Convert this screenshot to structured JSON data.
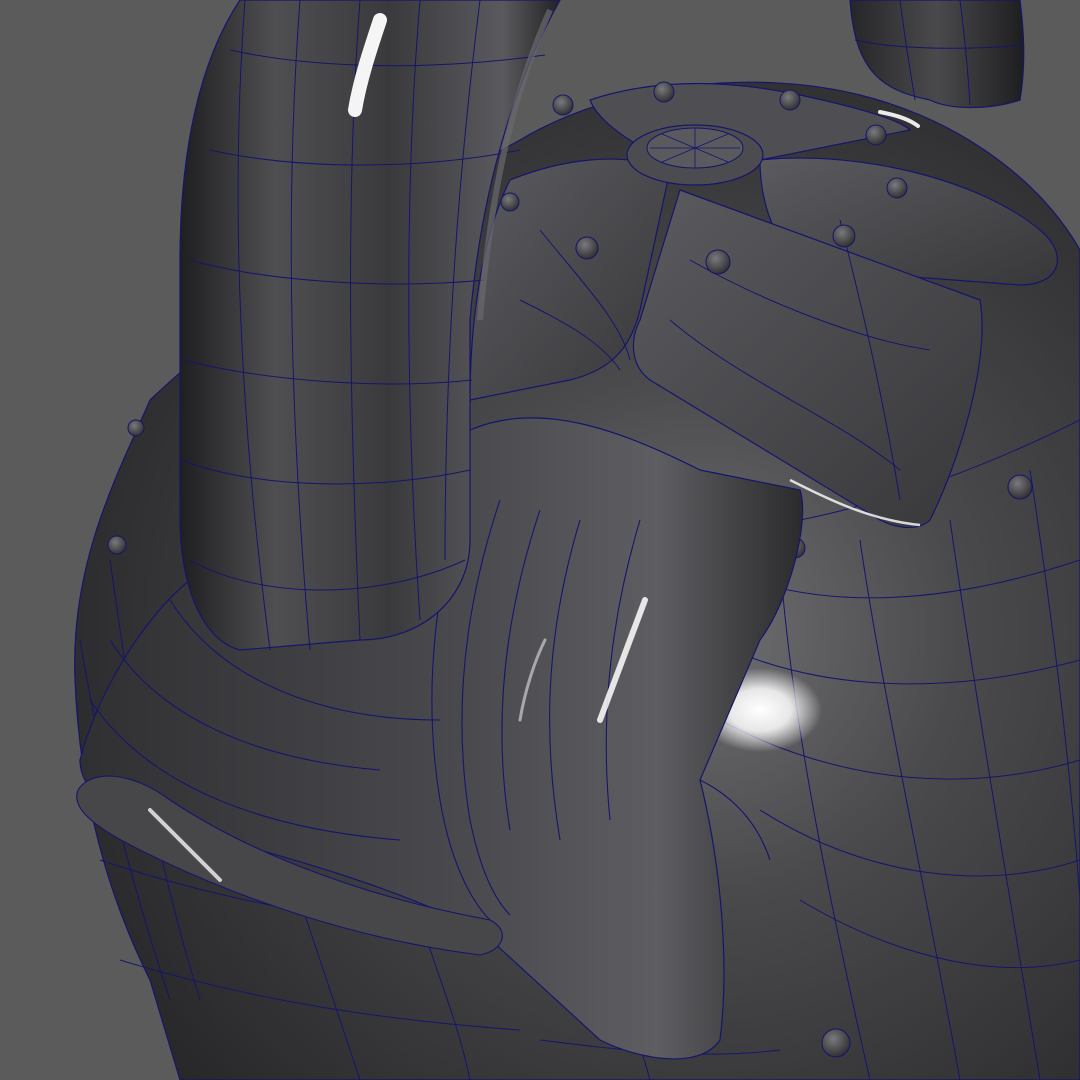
{
  "viewport": {
    "background_color": "#5b5b5b",
    "object_shade_color": "#3c3c3e",
    "highlight_color": "#ffffff",
    "wireframe_color": "#15156e"
  },
  "scene": {
    "subject": "kettlebell-3d-model",
    "display_mode": "smooth-shaded-with-wireframe",
    "parts": [
      "handle",
      "collar",
      "body",
      "decorative-petals",
      "rivets",
      "center-cap"
    ]
  }
}
